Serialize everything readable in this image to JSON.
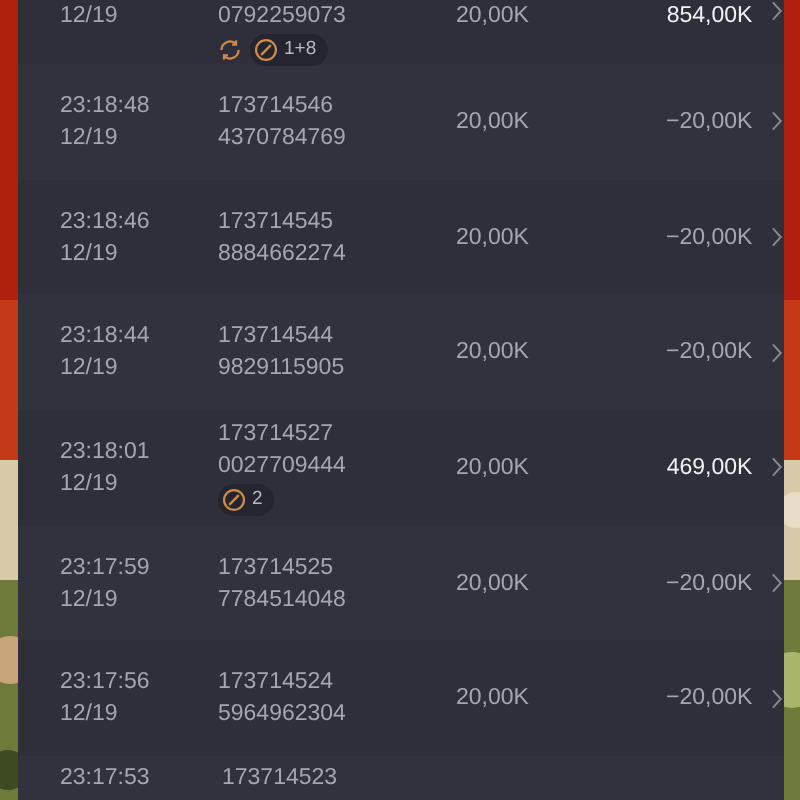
{
  "rows": [
    {
      "date": "12/19",
      "id_line2": "0792259073",
      "bet": "20,00K",
      "result": "854,00K",
      "highlight": true,
      "badges": [
        {
          "kind": "refresh"
        },
        {
          "kind": "pill",
          "label": "1+8"
        }
      ]
    },
    {
      "time": "23:18:48",
      "date": "12/19",
      "id_line1": "173714546",
      "id_line2": "4370784769",
      "bet": "20,00K",
      "result": "−20,00K",
      "highlight": false,
      "badges": []
    },
    {
      "time": "23:18:46",
      "date": "12/19",
      "id_line1": "173714545",
      "id_line2": "8884662274",
      "bet": "20,00K",
      "result": "−20,00K",
      "highlight": false,
      "badges": []
    },
    {
      "time": "23:18:44",
      "date": "12/19",
      "id_line1": "173714544",
      "id_line2": "9829115905",
      "bet": "20,00K",
      "result": "−20,00K",
      "highlight": false,
      "badges": []
    },
    {
      "time": "23:18:01",
      "date": "12/19",
      "id_line1": "173714527",
      "id_line2": "0027709444",
      "bet": "20,00K",
      "result": "469,00K",
      "highlight": true,
      "badges": [
        {
          "kind": "pill",
          "label": "2"
        }
      ]
    },
    {
      "time": "23:17:59",
      "date": "12/19",
      "id_line1": "173714525",
      "id_line2": "7784514048",
      "bet": "20,00K",
      "result": "−20,00K",
      "highlight": false,
      "badges": []
    },
    {
      "time": "23:17:56",
      "date": "12/19",
      "id_line1": "173714524",
      "id_line2": "5964962304",
      "bet": "20,00K",
      "result": "−20,00K",
      "highlight": false,
      "badges": []
    },
    {
      "time": "23:17:53",
      "id_line1": "173714523"
    }
  ]
}
